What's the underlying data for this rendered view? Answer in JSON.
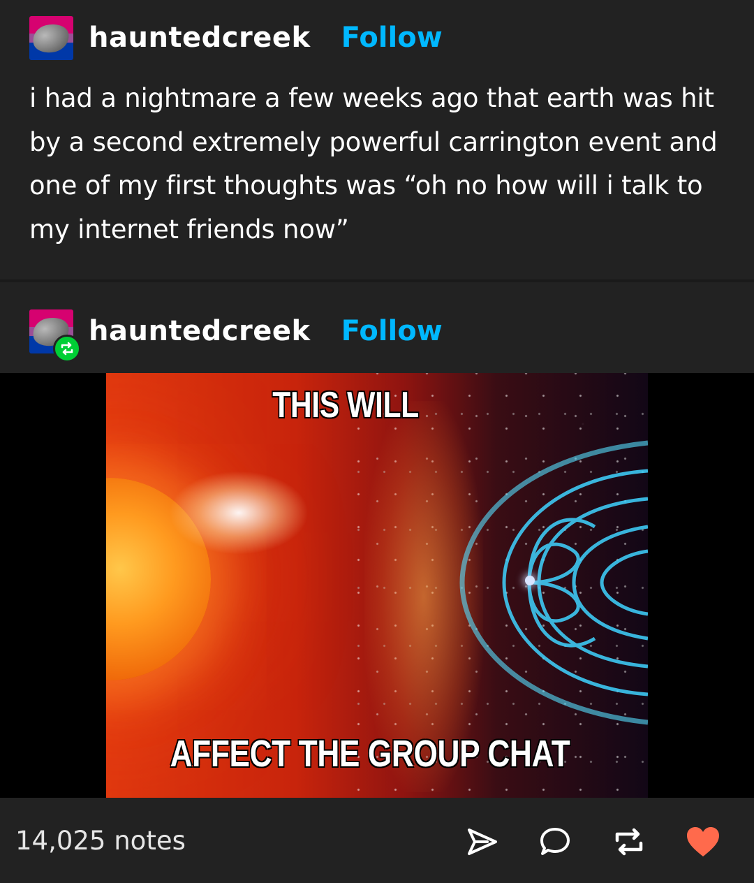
{
  "post": {
    "username": "hauntedcreek",
    "follow_label": "Follow",
    "text": "i had a nightmare a few weeks ago that earth was hit by a second   extremely powerful carrington event and one of my first thoughts was “oh no how will i talk to my internet friends now”"
  },
  "reblog": {
    "username": "hauntedcreek",
    "follow_label": "Follow"
  },
  "meme": {
    "top_text": "THIS WILL",
    "bottom_text": "AFFECT THE GROUP CHAT"
  },
  "footer": {
    "notes": "14,025 notes",
    "icons": [
      "share-icon",
      "reply-icon",
      "reblog-icon",
      "like-icon"
    ]
  },
  "colors": {
    "background": "#222222",
    "follow": "#00b8ff",
    "reblog_badge": "#00cf35",
    "like": "#ff6a4c"
  }
}
